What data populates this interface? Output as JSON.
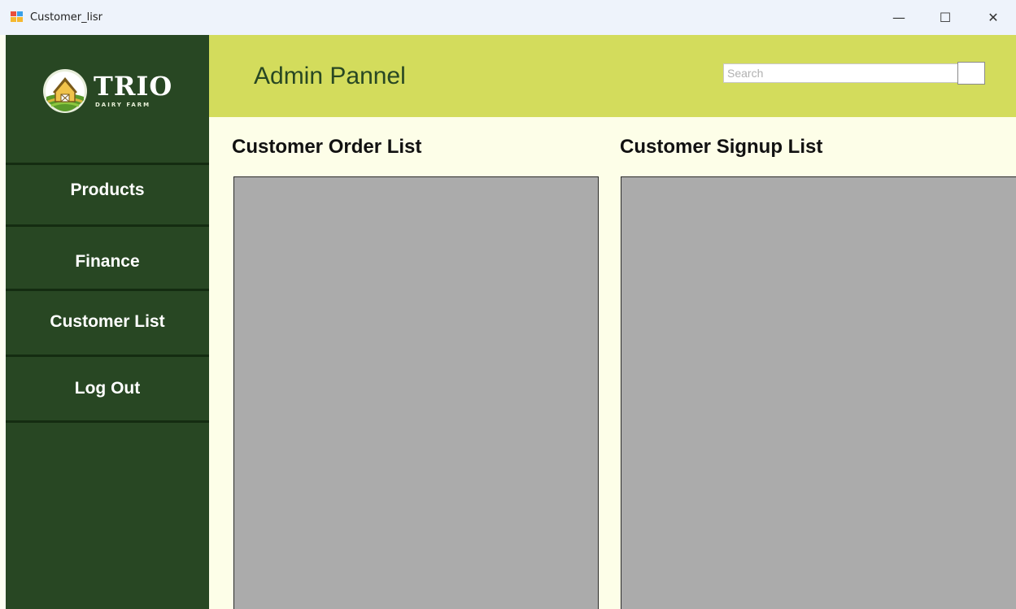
{
  "window": {
    "title": "Customer_lisr",
    "minimize_glyph": "—",
    "maximize_glyph": "☐",
    "close_glyph": "✕"
  },
  "logo": {
    "name": "TRIO",
    "subtitle": "DAIRY FARM"
  },
  "sidebar": {
    "items": [
      {
        "label": "Products"
      },
      {
        "label": "Finance"
      },
      {
        "label": "Customer List"
      },
      {
        "label": "Log Out"
      }
    ]
  },
  "header": {
    "title": "Admin Pannel",
    "search_placeholder": "Search"
  },
  "main": {
    "order_list_title": "Customer Order List",
    "signup_list_title": "Customer Signup List"
  },
  "colors": {
    "sidebar_bg": "#284723",
    "header_bg": "#d3dc5c",
    "content_bg": "#fdfee8",
    "panel_bg": "#ababab"
  }
}
